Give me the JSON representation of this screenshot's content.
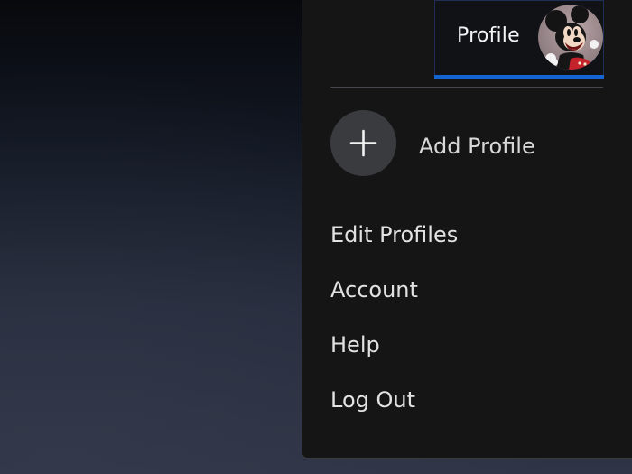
{
  "profile_header": {
    "name": "Profile",
    "avatar_icon": "mickey-mouse-avatar-icon",
    "active_indicator_color": "#1464d2"
  },
  "add_profile": {
    "icon": "plus-icon",
    "label": "Add Profile"
  },
  "menu": {
    "items": [
      {
        "label": "Edit Profiles"
      },
      {
        "label": "Account"
      },
      {
        "label": "Help"
      },
      {
        "label": "Log Out"
      }
    ]
  },
  "colors": {
    "menu_background": "#151515",
    "text_primary": "#e2e2e2",
    "add_circle": "#3a3b3f"
  }
}
